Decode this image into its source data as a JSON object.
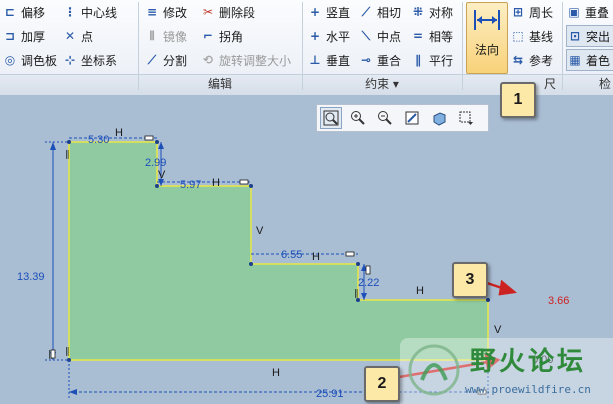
{
  "ribbon": {
    "col1": [
      "偏移",
      "加厚",
      "调色板"
    ],
    "col2": [
      "中心线",
      "点",
      "坐标系"
    ],
    "col3": [
      "修改",
      "镜像",
      "分割"
    ],
    "col4": [
      "删除段",
      "拐角",
      "旋转调整大小"
    ],
    "col5": [
      "竖直",
      "水平",
      "垂直"
    ],
    "col6": [
      "相切",
      "中点",
      "重合"
    ],
    "col7": [
      "对称",
      "相等",
      "平行"
    ],
    "normal_button": "法向",
    "col9": [
      "周长",
      "基线",
      "参考"
    ],
    "col10": [
      "重叠",
      "突出",
      "着色"
    ],
    "groups": {
      "edit": "编辑",
      "constrain": "约束 ▾",
      "dim_partial": "尺",
      "inspect_partial": "检"
    }
  },
  "sketch": {
    "dims": {
      "d530": "5.30",
      "d299": "2.99",
      "d597": "5.97",
      "d655": "6.55",
      "d222": "2.22",
      "d1339": "13.39",
      "d2591": "25.91",
      "d366": "3.66",
      "d000": "0.00"
    },
    "constraints": {
      "H": "H",
      "V": "V"
    }
  },
  "callouts": [
    "1",
    "2",
    "3"
  ],
  "watermark": {
    "title": "野火论坛",
    "url": "www.proewildfire.cn"
  },
  "colors": {
    "fill": "#8fcaa0",
    "edge": "#e8e845",
    "dim": "#1c4fb8",
    "red": "#cc2222"
  }
}
